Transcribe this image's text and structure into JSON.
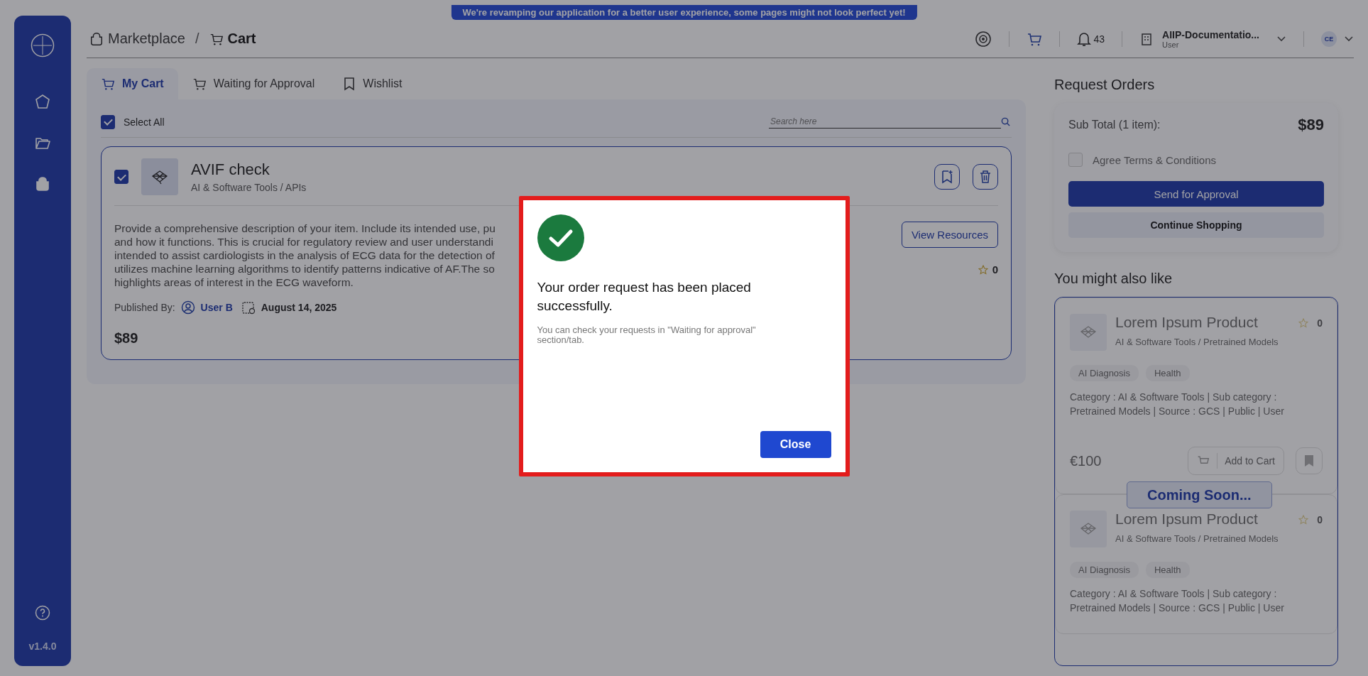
{
  "banner": "We're revamping our application for a better user experience, some pages might not look perfect yet!",
  "sidebar": {
    "items": [
      {
        "kind": "home",
        "selected": false
      },
      {
        "kind": "folder",
        "selected": false
      },
      {
        "kind": "bag",
        "selected": true
      }
    ],
    "version": "v1.4.0"
  },
  "breadcrumb": {
    "items": [
      {
        "label": "Marketplace",
        "kind": "bag",
        "current": false
      },
      {
        "label": "Cart",
        "kind": "cart",
        "current": true
      }
    ],
    "separator": "/"
  },
  "header": {
    "notifications": "43",
    "account": {
      "name": "AIIP-Documentatio...",
      "role": "User"
    },
    "avatar": "CE"
  },
  "tabs": [
    {
      "label": "My Cart",
      "kind": "cart",
      "selected": true
    },
    {
      "label": "Waiting for Approval",
      "kind": "cart-wait",
      "selected": false
    },
    {
      "label": "Wishlist",
      "kind": "bookmark",
      "selected": false
    }
  ],
  "cart": {
    "select_all": {
      "label": "Select All",
      "checked": true
    },
    "search": {
      "placeholder": "Search here"
    },
    "items": [
      {
        "checked": true,
        "title": "AVIF check",
        "category": "AI & Software Tools / APIs",
        "description_lines": [
          "Provide a comprehensive description of your item. Include its intended use, pu",
          "and how it functions. This is crucial for regulatory review and user understandi",
          "intended to assist cardiologists in the analysis of ECG data for the detection of",
          "utilizes machine learning algorithms to identify patterns indicative of AF.The so",
          "highlights areas of interest in the ECG waveform."
        ],
        "view_button": "View Resources",
        "rating": "0",
        "published_label": "Published By:",
        "publisher": "User B",
        "date": "August 14, 2025",
        "price": "$89"
      }
    ]
  },
  "summary": {
    "title": "Request Orders",
    "subtotal_label": "Sub Total (1 item):",
    "subtotal": "$89",
    "terms": {
      "label": "Agree Terms & Conditions",
      "checked": false
    },
    "primary_button": "Send for Approval",
    "secondary_button": "Continue Shopping"
  },
  "recommendations": {
    "title": "You might also like",
    "badge": "Coming Soon...",
    "products": [
      {
        "title": "Lorem Ipsum Product",
        "category": "AI & Software Tools / Pretrained Models",
        "rating": "0",
        "tags": [
          "AI Diagnosis",
          "Health"
        ],
        "details": "Category : AI & Software Tools | Sub category : Pretrained Models | Source : GCS | Public | User",
        "price": "€100",
        "cart_button": "Add to Cart"
      },
      {
        "title": "Lorem Ipsum Product",
        "category": "AI & Software Tools / Pretrained Models",
        "rating": "0",
        "tags": [
          "AI Diagnosis",
          "Health"
        ],
        "details": "Category : AI & Software Tools | Sub category : Pretrained Models | Source : GCS | Public | User"
      }
    ]
  },
  "modal": {
    "title": "Your order request has been placed successfully.",
    "message": "You can check your requests in \"Waiting for approval\" section/tab.",
    "button": "Close"
  }
}
